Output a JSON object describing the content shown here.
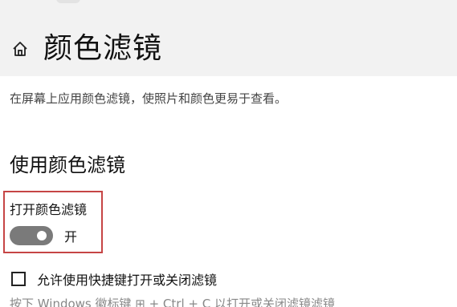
{
  "header": {
    "home_icon": "home-icon",
    "title": "颜色滤镜"
  },
  "description": "在屏幕上应用颜色滤镜，使照片和颜色更易于查看。",
  "section": {
    "title": "使用颜色滤镜"
  },
  "toggle": {
    "label": "打开颜色滤镜",
    "state_text": "开",
    "is_on": true
  },
  "checkbox": {
    "label": "允许使用快捷键打开或关闭滤镜",
    "checked": false
  },
  "hint": {
    "text": "按下 Windows 徽标键 ⊞ + Ctrl + C 以打开或关闭滤镜滤镜"
  },
  "colors": {
    "highlight_border": "#c64545",
    "toggle_track": "#7a7a7a",
    "header_bg": "#f2f2f2"
  }
}
